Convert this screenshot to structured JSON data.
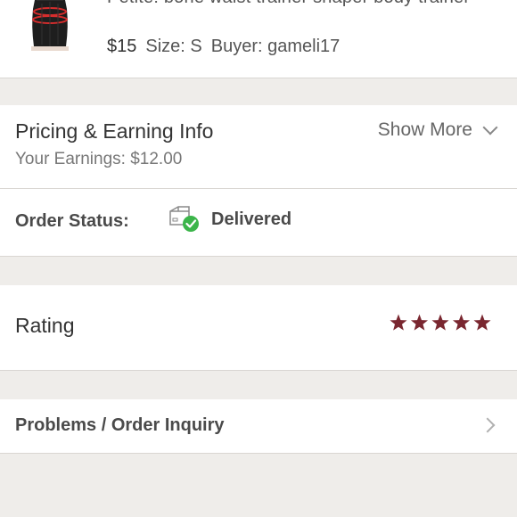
{
  "listing": {
    "title": "Petite! bone waist trainer shaper body trainer",
    "price": "$15",
    "size": "Size: S",
    "buyer": "Buyer: gameli17",
    "thumbnail": "waist-trainer-photo"
  },
  "pricing": {
    "title": "Pricing & Earning Info",
    "earnings": "Your Earnings: $12.00",
    "show_more": "Show More",
    "show_more_icon": "chevron-down-icon"
  },
  "order_status": {
    "label": "Order Status:",
    "value": "Delivered",
    "icon": "delivered-box-check-icon",
    "check_color": "#3bb54a"
  },
  "rating": {
    "label": "Rating",
    "stars": 5,
    "max_stars": 5,
    "star_color": "#7a2730"
  },
  "problems": {
    "label": "Problems / Order Inquiry",
    "icon": "chevron-right-icon"
  }
}
